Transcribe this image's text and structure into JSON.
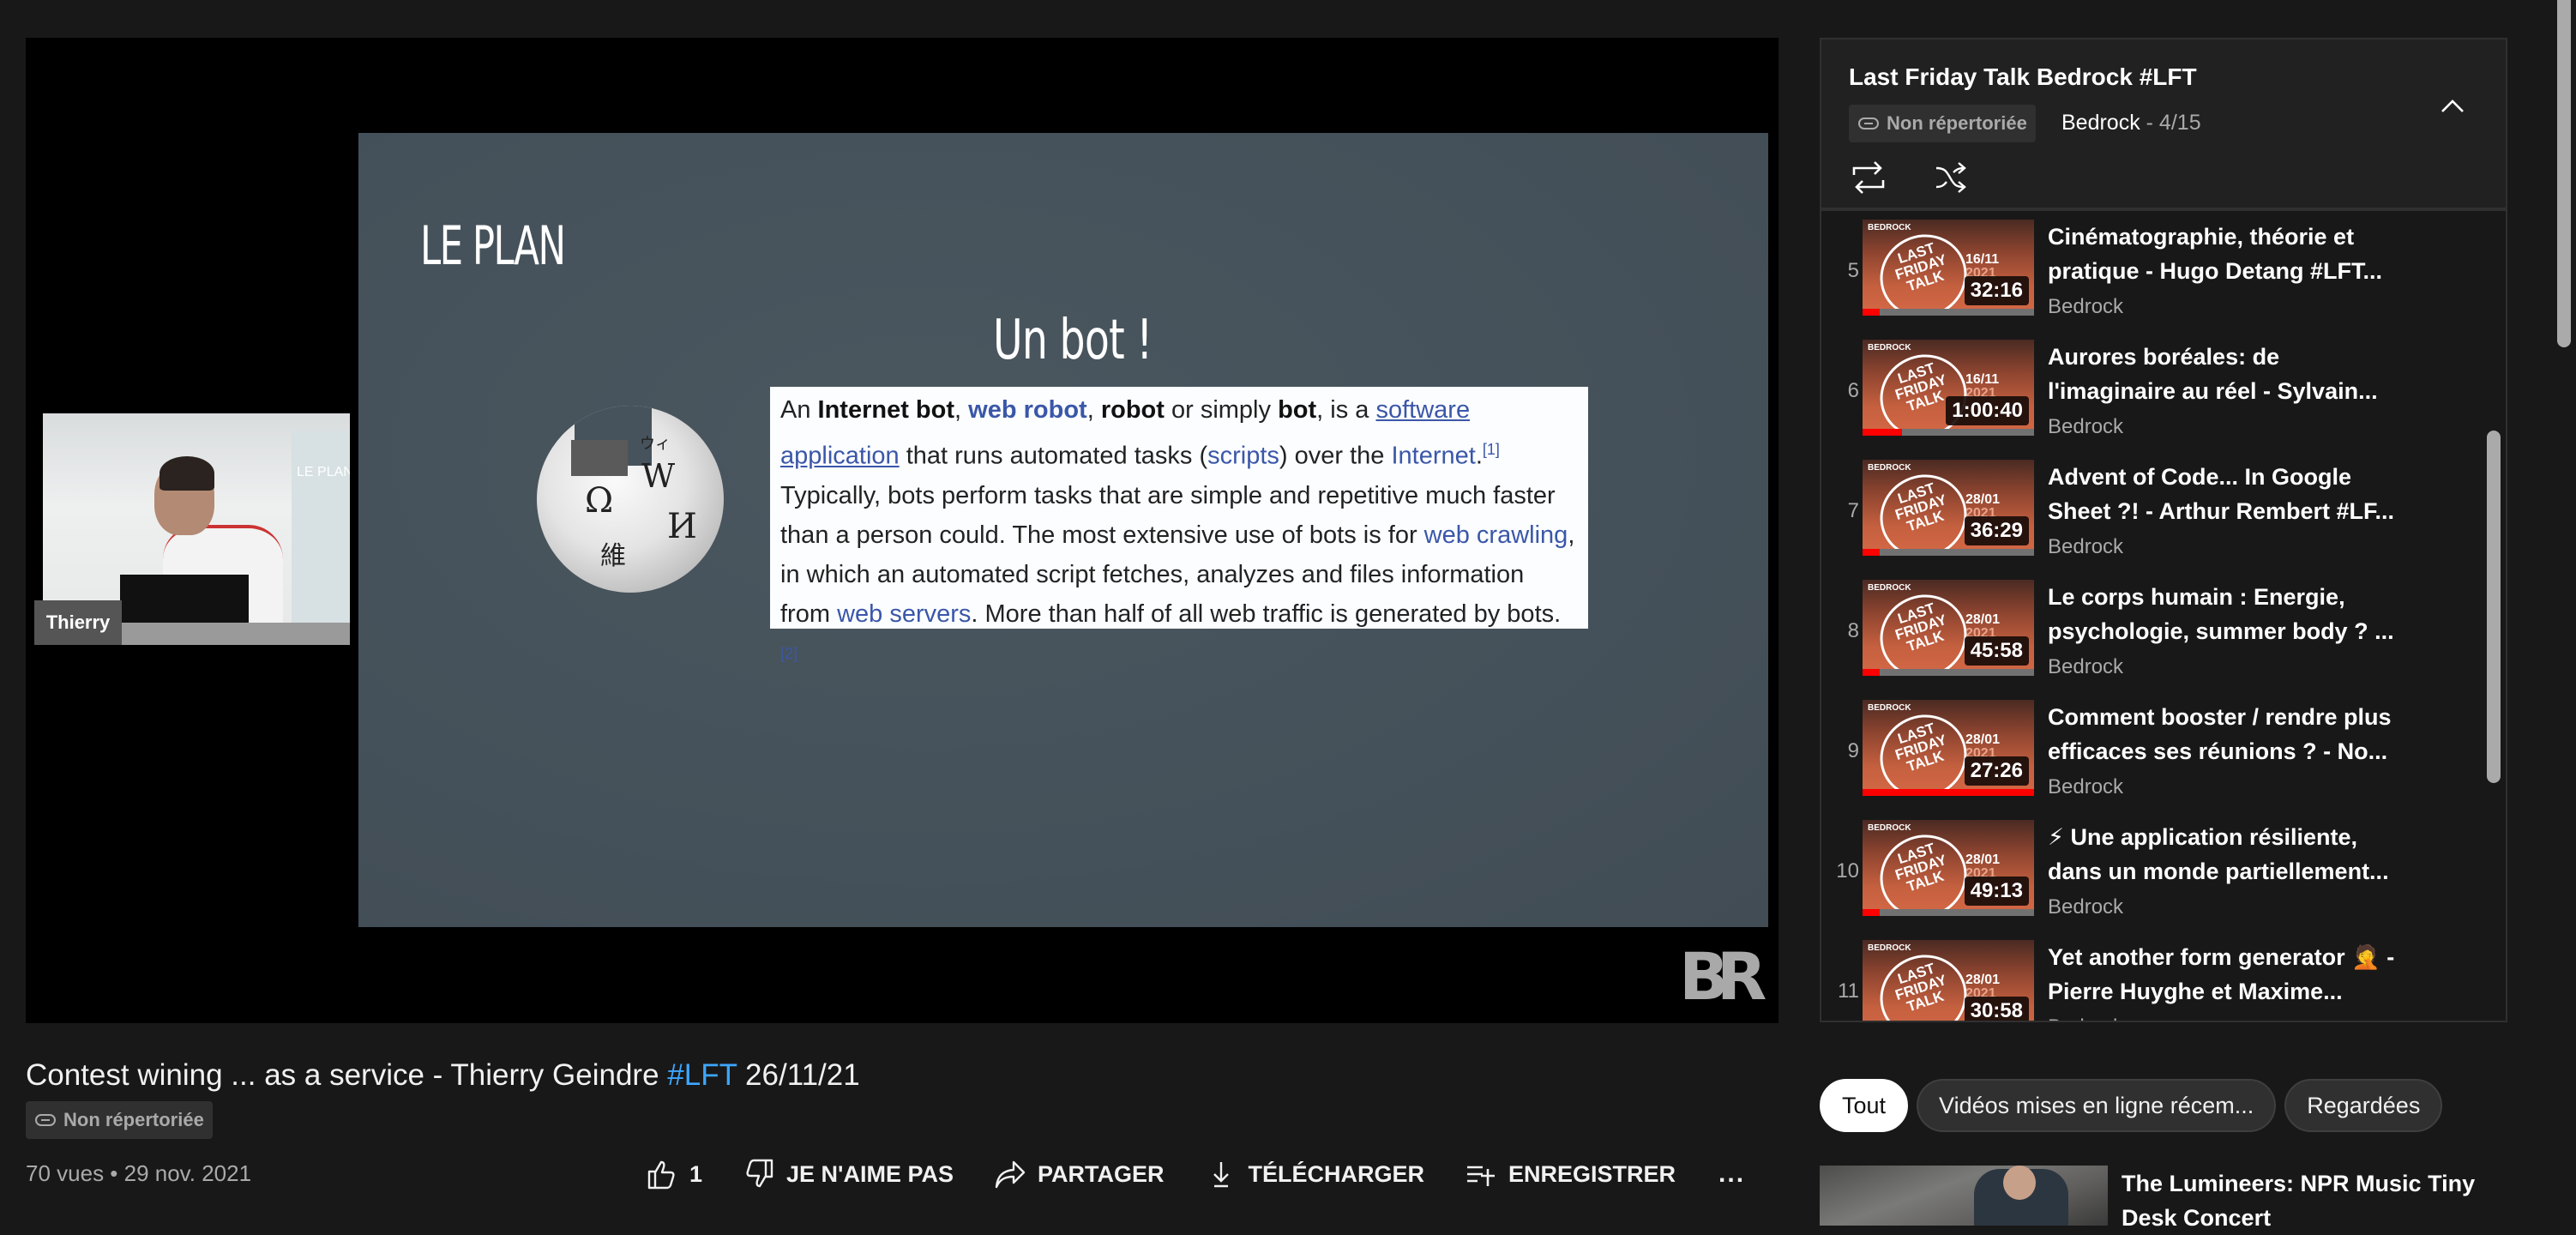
{
  "video": {
    "slide_heading": "LE PLAN",
    "slide_subheading": "Un bot !",
    "wiki_paragraph": {
      "t1": "An ",
      "b1": "Internet bot",
      "t2": ", ",
      "l1": "web robot",
      "t3": ", ",
      "b2": "robot",
      "t4": " or simply ",
      "b3": "bot",
      "t5": ", is a ",
      "u1": "software application",
      "t6": " that runs automated tasks (",
      "l2": "scripts",
      "t7": ") over the ",
      "l3": "Internet",
      "t8": ".",
      "s1": "[1]",
      "t9": " Typically, bots perform tasks that are simple and repetitive much faster than a person could. The most extensive use of bots is for ",
      "l4": "web crawling",
      "t10": ", in which an automated script fetches, analyzes and files information from ",
      "l5": "web servers",
      "t11": ". More than half of all web traffic is generated by bots.",
      "s2": "[2]"
    },
    "globe_glyphs": [
      "Ω",
      "W",
      "И",
      "維",
      "ウィ"
    ],
    "speaker_label": "Thierry",
    "camera_screen_text": "LE PLAN",
    "watermark": "BR"
  },
  "info": {
    "title_main": "Contest wining ... as a service - Thierry Geindre ",
    "title_hashtag": "#LFT",
    "title_date": " 26/11/21",
    "visibility": "Non répertoriée",
    "views_date": "70 vues • 29 nov. 2021",
    "actions": {
      "like_count": "1",
      "dislike": "JE N'AIME PAS",
      "share": "PARTAGER",
      "download": "TÉLÉCHARGER",
      "save": "ENREGISTRER",
      "more": "..."
    }
  },
  "playlist": {
    "title": "Last Friday Talk Bedrock #LFT",
    "visibility": "Non répertoriée",
    "owner": "Bedrock",
    "position": " - 4/15",
    "items": [
      {
        "index": "5",
        "title": "Cinématographie, théorie et pratique - Hugo Detang #LFT...",
        "channel": "Bedrock",
        "duration": "32:16",
        "thumb_date": "16/11",
        "thumb_year": "2021",
        "watched": 0.1
      },
      {
        "index": "6",
        "title": "Aurores boréales: de l'imaginaire au réel - Sylvain...",
        "channel": "Bedrock",
        "duration": "1:00:40",
        "thumb_date": "16/11",
        "thumb_year": "2021",
        "watched": 0.23
      },
      {
        "index": "7",
        "title": "Advent of Code... In Google Sheet ?! - Arthur Rembert #LF...",
        "channel": "Bedrock",
        "duration": "36:29",
        "thumb_date": "28/01",
        "thumb_year": "2021",
        "watched": 0.1
      },
      {
        "index": "8",
        "title": "Le corps humain : Energie, psychologie, summer body ? ...",
        "channel": "Bedrock",
        "duration": "45:58",
        "thumb_date": "28/01",
        "thumb_year": "2021",
        "watched": 0.1
      },
      {
        "index": "9",
        "title": "Comment booster / rendre plus efficaces ses réunions ? - No...",
        "channel": "Bedrock",
        "duration": "27:26",
        "thumb_date": "28/01",
        "thumb_year": "2021",
        "watched": 1.0
      },
      {
        "index": "10",
        "title": "⚡ Une application résiliente, dans un monde partiellement...",
        "channel": "Bedrock",
        "duration": "49:13",
        "thumb_date": "28/01",
        "thumb_year": "2021",
        "watched": 0.1
      },
      {
        "index": "11",
        "title": "Yet another form generator 🤦 - Pierre Huyghe et Maxime...",
        "channel": "Bedrock",
        "duration": "30:58",
        "thumb_date": "28/01",
        "thumb_year": "2021",
        "watched": 0
      }
    ],
    "thumb_brand": "BEDROCK",
    "thumb_logo": "LAST FRIDAY TALK"
  },
  "chips": [
    "Tout",
    "Vidéos mises en ligne récem...",
    "Regardées"
  ],
  "recommended": {
    "title": "The Lumineers: NPR Music Tiny Desk Concert"
  },
  "colors": {
    "background": "#181818",
    "accent_link": "#3ea6ff",
    "progress_red": "#ff0000",
    "thumb_orange": "#d46846"
  }
}
